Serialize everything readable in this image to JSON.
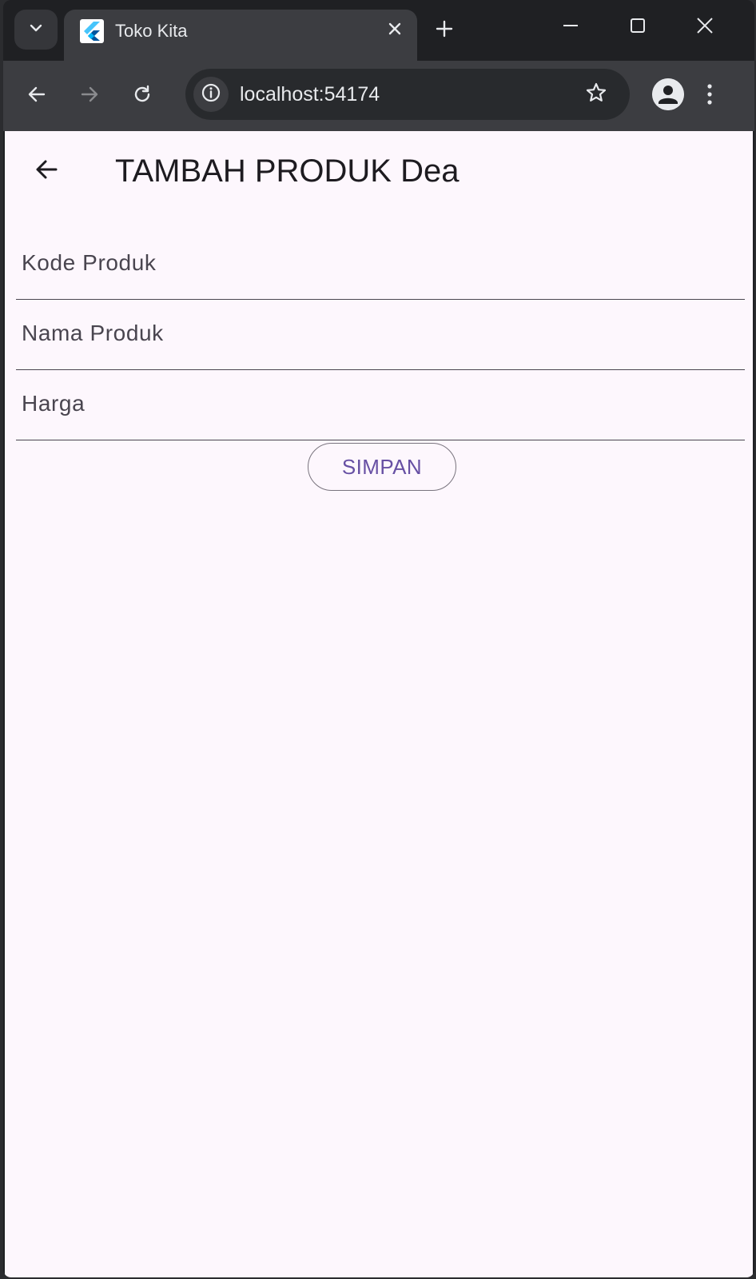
{
  "browser": {
    "tab": {
      "title": "Toko Kita",
      "favicon": "flutter-icon"
    },
    "address_bar": {
      "url": "localhost:54174"
    },
    "icons": {
      "tab_search": "chevron-down-icon",
      "tab_close": "close-icon",
      "new_tab": "plus-icon",
      "minimize": "minimize-icon",
      "maximize": "maximize-icon",
      "close": "close-icon",
      "back": "arrow-left-icon",
      "forward": "arrow-right-icon",
      "reload": "reload-icon",
      "site_info": "info-icon",
      "bookmark": "star-icon",
      "profile": "profile-icon",
      "menu": "kebab-menu-icon"
    }
  },
  "app": {
    "appbar": {
      "title": "TAMBAH PRODUK Dea",
      "back_icon": "arrow-left-icon"
    },
    "form": {
      "fields": [
        {
          "placeholder": "Kode Produk",
          "value": ""
        },
        {
          "placeholder": "Nama Produk",
          "value": ""
        },
        {
          "placeholder": "Harga",
          "value": ""
        }
      ],
      "submit_label": "SIMPAN"
    }
  },
  "colors": {
    "page_background": "#fdf7fd",
    "primary": "#6750a4",
    "outline": "#79747e",
    "on_surface": "#1d1b20",
    "browser_frame": "#1f2023",
    "browser_toolbar": "#3c3d41"
  }
}
